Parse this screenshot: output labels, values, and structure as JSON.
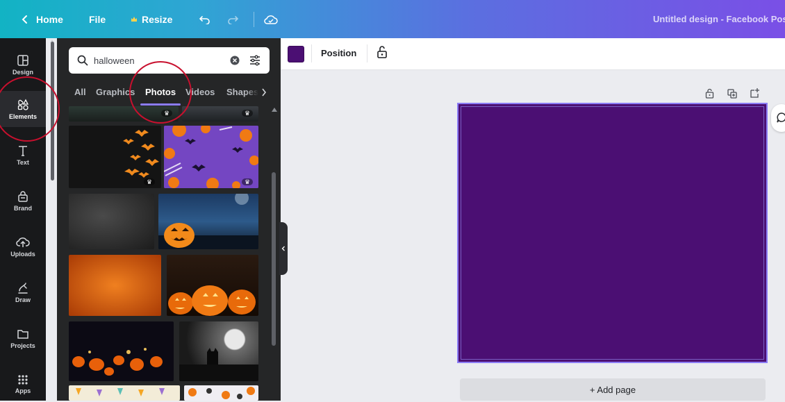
{
  "topbar": {
    "home_label": "Home",
    "file_label": "File",
    "resize_label": "Resize",
    "title": "Untitled design - Facebook Pos"
  },
  "rail": {
    "items": [
      {
        "label": "Design",
        "icon": "design-icon"
      },
      {
        "label": "Elements",
        "icon": "elements-icon"
      },
      {
        "label": "Text",
        "icon": "text-icon"
      },
      {
        "label": "Brand",
        "icon": "brand-icon"
      },
      {
        "label": "Uploads",
        "icon": "uploads-icon"
      },
      {
        "label": "Draw",
        "icon": "draw-icon"
      },
      {
        "label": "Projects",
        "icon": "projects-icon"
      },
      {
        "label": "Apps",
        "icon": "apps-icon"
      }
    ],
    "active": "Elements"
  },
  "panel": {
    "search_value": "halloween",
    "tabs": [
      "All",
      "Graphics",
      "Photos",
      "Videos",
      "Shapes"
    ],
    "active_tab": "Photos"
  },
  "editor": {
    "color_swatch": "#4b0f73",
    "position_label": "Position",
    "canvas_color": "#4b0f73",
    "add_page_label": "+ Add page"
  },
  "colors": {
    "accent": "#8b7cf5",
    "annotation": "#c8102e"
  }
}
